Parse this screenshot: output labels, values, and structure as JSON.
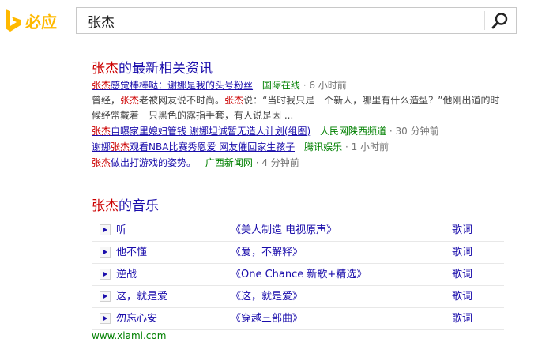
{
  "brand": {
    "name": "必应",
    "logo_color": "#ffb900"
  },
  "search": {
    "query": "张杰"
  },
  "news": {
    "title_hl": "张杰",
    "title_rest": "的最新相关资讯",
    "items": [
      {
        "hl": "张杰",
        "rest": "感觉棒棒哒：谢娜是我的头号粉丝",
        "source": "国际在线",
        "time": "· 6 小时前"
      },
      {
        "hl": "张杰",
        "rest": "自曝家里媳妇管钱 谢娜坦诚暂无造人计划(组图)",
        "source": "人民网陕西频道",
        "time": "· 30 分钟前"
      },
      {
        "pre": "谢娜",
        "hl": "张杰",
        "rest": "观看NBA比赛秀恩爱 网友催回家生孩子",
        "source": "腾讯娱乐",
        "time": "· 1 小时前"
      },
      {
        "hl": "张杰",
        "rest": "做出打游戏的姿势。",
        "source": "广西新闻网",
        "time": "· 4 分钟前"
      }
    ],
    "snippet": {
      "p1": "曾经，",
      "hl1": "张杰",
      "p2": "老被网友说不时尚。",
      "hl2": "张杰",
      "p3": "说：“当时我只是一个新人，哪里有什么造型？”他刚出道的时候经常戴着一只黑色的露指手套，有人说是因 ..."
    }
  },
  "music": {
    "title_hl": "张杰",
    "title_rest": "的音乐",
    "lyrics_label": "歌词",
    "songs": [
      {
        "name": "听",
        "album": "《美人制造 电视原声》"
      },
      {
        "name": "他不懂",
        "album": "《爱，不解释》"
      },
      {
        "name": "逆战",
        "album": "《One Chance 新歌+精选》"
      },
      {
        "name": "这，就是爱",
        "album": "《这，就是爱》"
      },
      {
        "name": "勿忘心安",
        "album": "《穿越三部曲》"
      }
    ],
    "source_link": "www.xiami.com"
  }
}
